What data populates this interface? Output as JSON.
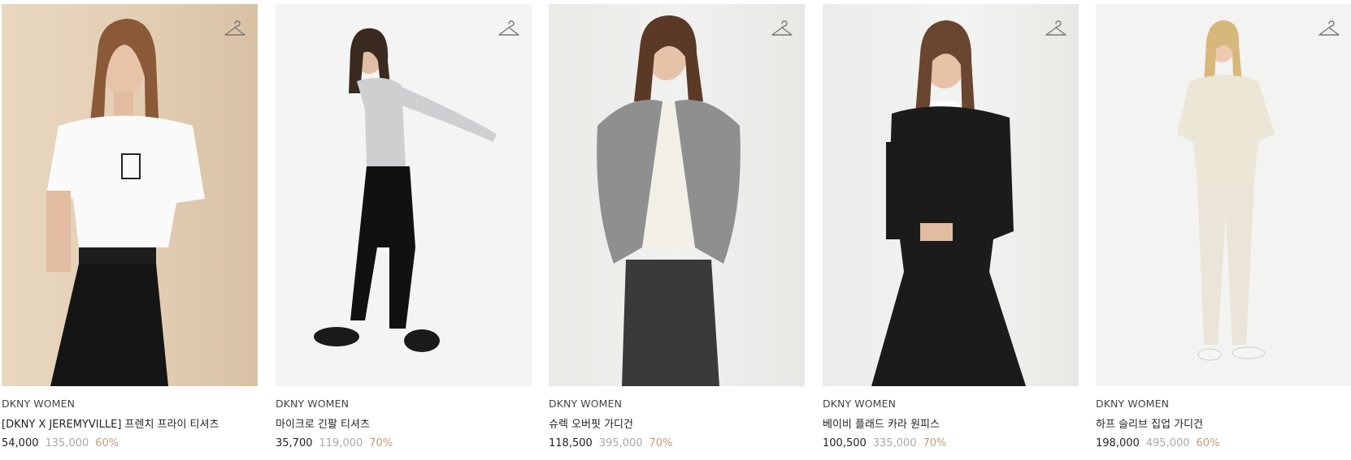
{
  "icons": {
    "wishlist": "hanger-icon"
  },
  "colors": {
    "discount": "#c29a7a",
    "original_price": "#a9a9a9"
  },
  "products": [
    {
      "brand": "DKNY WOMEN",
      "name": "[DKNY X JEREMYVILLE] 프렌치 프라이 티셔츠",
      "sale_price": "54,000",
      "original_price": "135,000",
      "discount": "60%"
    },
    {
      "brand": "DKNY WOMEN",
      "name": "마이크로 긴팔 티셔츠",
      "sale_price": "35,700",
      "original_price": "119,000",
      "discount": "70%"
    },
    {
      "brand": "DKNY WOMEN",
      "name": "슈렉 오버핏 가디건",
      "sale_price": "118,500",
      "original_price": "395,000",
      "discount": "70%"
    },
    {
      "brand": "DKNY WOMEN",
      "name": "베이비 플래드 카라 원피스",
      "sale_price": "100,500",
      "original_price": "335,000",
      "discount": "70%"
    },
    {
      "brand": "DKNY WOMEN",
      "name": "하프 슬리브 집업 가디건",
      "sale_price": "198,000",
      "original_price": "495,000",
      "discount": "60%"
    }
  ]
}
